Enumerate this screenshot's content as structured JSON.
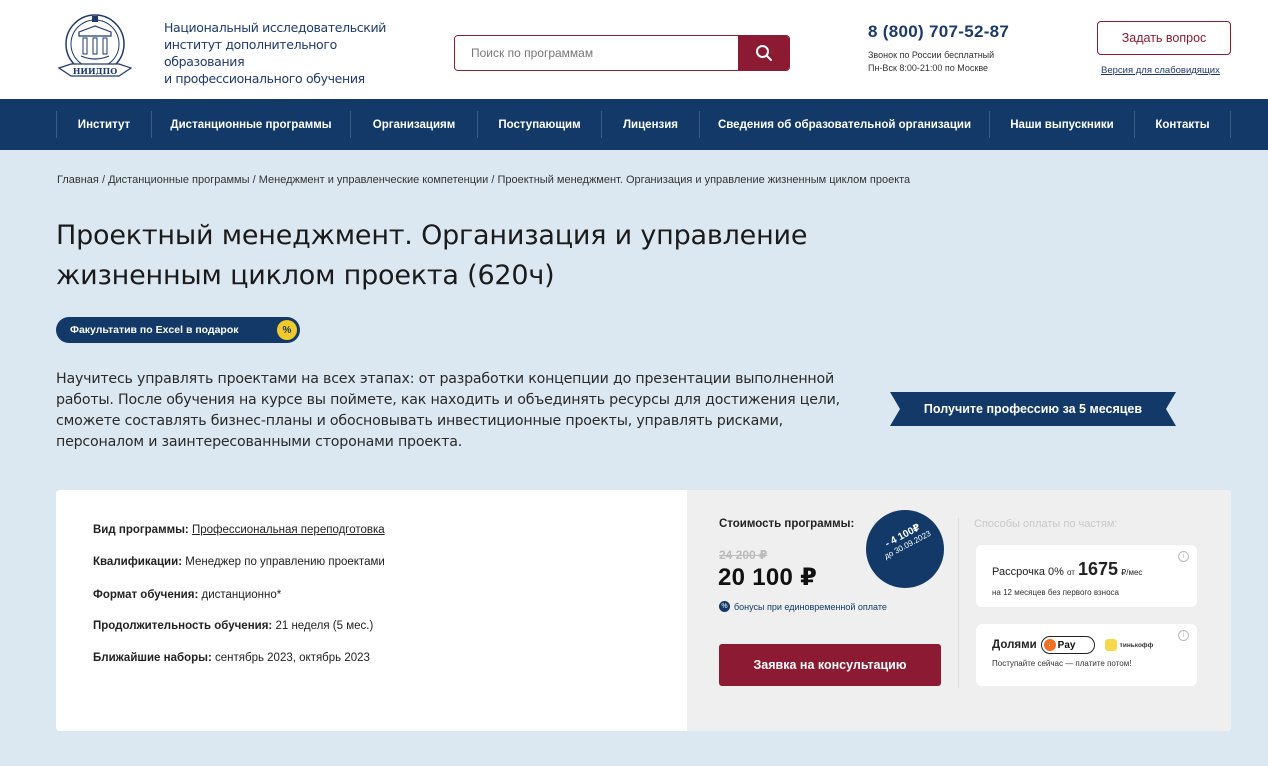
{
  "header": {
    "logo_text": "НИИДПО",
    "org_name_line1": "Национальный исследовательский",
    "org_name_line2": "институт дополнительного образования",
    "org_name_line3": "и профессионального обучения",
    "search_placeholder": "Поиск по программам",
    "search_icon": "search-icon",
    "phone": "8 (800) 707-52-87",
    "phone_note1": "Звонок по России бесплатный",
    "phone_note2": "Пн-Вск 8:00-21:00 по Москве",
    "ask_button": "Задать вопрос",
    "vision_link": "Версия для слабовидящих"
  },
  "nav": {
    "items": [
      {
        "label": "Институт"
      },
      {
        "label": "Дистанционные программы"
      },
      {
        "label": "Организациям"
      },
      {
        "label": "Поступающим"
      },
      {
        "label": "Лицензия"
      },
      {
        "label": "Сведения об образовательной организации"
      },
      {
        "label": "Наши выпускники"
      },
      {
        "label": "Контакты"
      }
    ]
  },
  "breadcrumb": {
    "items": [
      "Главная",
      "Дистанционные программы",
      "Менеджмент и управленческие компетенции",
      "Проектный менеджмент. Организация и управление жизненным циклом проекта"
    ],
    "separator": "/"
  },
  "page": {
    "title_line1": "Проектный менеджмент. Организация и управление",
    "title_line2": "жизненным циклом проекта (620ч)",
    "badge": "Факультатив по Excel в подарок",
    "badge_pct": "%",
    "description": "Научитесь управлять проектами на всех этапах: от разработки концепции до презентации выполненной работы. После обучения на курсе вы поймете, как находить и объединять ресурсы для достижения цели, сможете составлять бизнес-планы и обосновывать инвестиционные проекты, управлять рисками, персоналом и заинтересованными сторонами проекта.",
    "ribbon": "Получите профессию за 5 месяцев"
  },
  "card": {
    "info": [
      {
        "label": "Вид программы:",
        "value": "Профессиональная переподготовка"
      },
      {
        "label": "Квалификации:",
        "value": "Менеджер по управлению проектами"
      },
      {
        "label": "Формат обучения:",
        "value": "дистанционно*"
      },
      {
        "label": "Продолжительность обучения:",
        "value": "21 неделя (5 мес.)"
      },
      {
        "label": "Ближайшие наборы:",
        "value": "сентябрь 2023, октябрь 2023"
      }
    ],
    "price_label": "Стоимость программы:",
    "old_price": "24 200 ₽",
    "new_price": "20 100 ₽",
    "bonus_icon": "%",
    "bonus_text": "бонусы при единовременной оплате",
    "discount_amount": "- 4 100₽",
    "discount_date": "до 30.09.2023",
    "consult_button": "Заявка на консультацию",
    "installment_title": "Способы оплаты по частям:",
    "installment": {
      "label": "Рассрочка 0%",
      "from": "от",
      "amount": "1675",
      "unit": "₽/мес",
      "note": "на 12 месяцев без первого взноса"
    },
    "dolyami": {
      "label": "Долями",
      "pay_mark": "Pay",
      "bank": "тинькофф",
      "note": "Поступайте сейчас — платите потом!"
    },
    "info_icon": "i"
  }
}
